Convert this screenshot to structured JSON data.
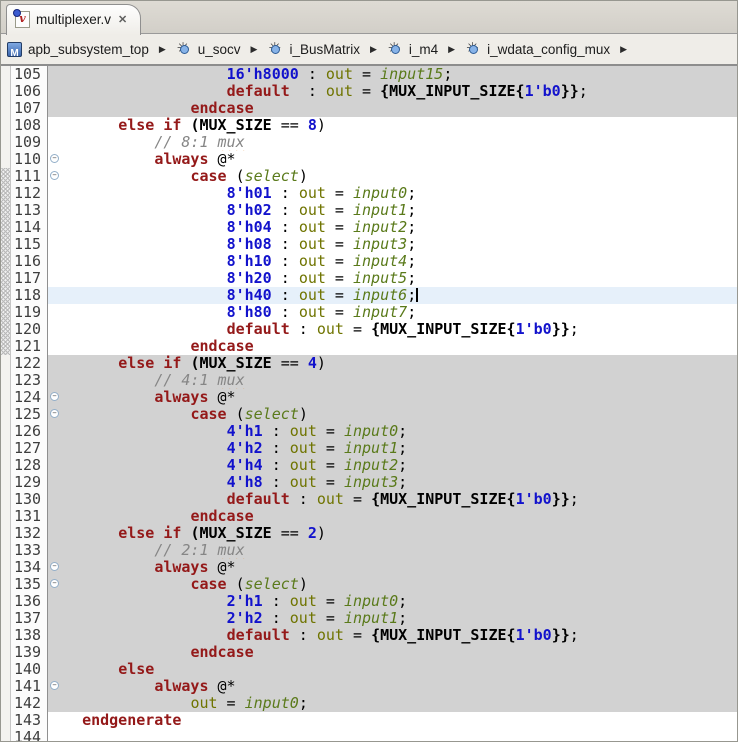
{
  "window": {
    "tab_title": "multiplexer.v",
    "close_glyph": "✕"
  },
  "breadcrumb": {
    "arrow_glyph": "▶",
    "items": [
      {
        "label": "apb_subsystem_top",
        "icon": "module-icon"
      },
      {
        "label": "u_socv",
        "icon": "instance-icon"
      },
      {
        "label": "i_BusMatrix",
        "icon": "instance-icon"
      },
      {
        "label": "i_m4",
        "icon": "instance-icon"
      },
      {
        "label": "i_wdata_config_mux",
        "icon": "instance-icon"
      }
    ],
    "trailing_arrow": true
  },
  "editor": {
    "colors": {
      "keyword": "#941919",
      "literal": "#1212cc",
      "parameter": "#000000",
      "signal_out": "#6f7400",
      "port_italic": "#5a7a1a",
      "comment": "#868686",
      "inactive_block_bg": "#d2d2d2",
      "current_line_bg": "#e6f0fa"
    },
    "fold_glyph": "−",
    "lines": [
      {
        "n": "105",
        "bg": "gray",
        "seg": [
          [
            "t",
            "                  "
          ],
          [
            "n",
            "16'h8000"
          ],
          [
            "t",
            " : "
          ],
          [
            "o",
            "out"
          ],
          [
            "t",
            " = "
          ],
          [
            "i",
            "input15"
          ],
          [
            "t",
            ";"
          ]
        ]
      },
      {
        "n": "106",
        "bg": "gray",
        "seg": [
          [
            "t",
            "                  "
          ],
          [
            "k",
            "default"
          ],
          [
            "t",
            "  : "
          ],
          [
            "o",
            "out"
          ],
          [
            "t",
            " = "
          ],
          [
            "p",
            "{MUX_INPUT_SIZE{"
          ],
          [
            "n",
            "1'b0"
          ],
          [
            "p",
            "}}"
          ],
          [
            "t",
            ";"
          ]
        ]
      },
      {
        "n": "107",
        "bg": "gray",
        "seg": [
          [
            "t",
            "              "
          ],
          [
            "k",
            "endcase"
          ]
        ]
      },
      {
        "n": "108",
        "bg": "white",
        "seg": [
          [
            "t",
            "      "
          ],
          [
            "k",
            "else"
          ],
          [
            "t",
            " "
          ],
          [
            "k",
            "if"
          ],
          [
            "t",
            " "
          ],
          [
            "p",
            "(MUX_SIZE"
          ],
          [
            "t",
            " == "
          ],
          [
            "n",
            "8"
          ],
          [
            "t",
            ")"
          ]
        ]
      },
      {
        "n": "109",
        "bg": "white",
        "seg": [
          [
            "t",
            "          "
          ],
          [
            "c",
            "// 8:1 "
          ],
          [
            "m",
            "mux"
          ]
        ]
      },
      {
        "n": "110",
        "bg": "white",
        "fold": true,
        "seg": [
          [
            "t",
            "          "
          ],
          [
            "k",
            "always"
          ],
          [
            "t",
            " @*"
          ]
        ]
      },
      {
        "n": "111",
        "bg": "white",
        "fold": true,
        "range": true,
        "seg": [
          [
            "t",
            "              "
          ],
          [
            "k",
            "case"
          ],
          [
            "t",
            " ("
          ],
          [
            "i",
            "select"
          ],
          [
            "t",
            ")"
          ]
        ]
      },
      {
        "n": "112",
        "bg": "white",
        "range": true,
        "seg": [
          [
            "t",
            "                  "
          ],
          [
            "n",
            "8'h01"
          ],
          [
            "t",
            " : "
          ],
          [
            "o",
            "out"
          ],
          [
            "t",
            " = "
          ],
          [
            "i",
            "input0"
          ],
          [
            "t",
            ";"
          ]
        ]
      },
      {
        "n": "113",
        "bg": "white",
        "range": true,
        "seg": [
          [
            "t",
            "                  "
          ],
          [
            "n",
            "8'h02"
          ],
          [
            "t",
            " : "
          ],
          [
            "o",
            "out"
          ],
          [
            "t",
            " = "
          ],
          [
            "i",
            "input1"
          ],
          [
            "t",
            ";"
          ]
        ]
      },
      {
        "n": "114",
        "bg": "white",
        "range": true,
        "seg": [
          [
            "t",
            "                  "
          ],
          [
            "n",
            "8'h04"
          ],
          [
            "t",
            " : "
          ],
          [
            "o",
            "out"
          ],
          [
            "t",
            " = "
          ],
          [
            "i",
            "input2"
          ],
          [
            "t",
            ";"
          ]
        ]
      },
      {
        "n": "115",
        "bg": "white",
        "range": true,
        "seg": [
          [
            "t",
            "                  "
          ],
          [
            "n",
            "8'h08"
          ],
          [
            "t",
            " : "
          ],
          [
            "o",
            "out"
          ],
          [
            "t",
            " = "
          ],
          [
            "i",
            "input3"
          ],
          [
            "t",
            ";"
          ]
        ]
      },
      {
        "n": "116",
        "bg": "white",
        "range": true,
        "seg": [
          [
            "t",
            "                  "
          ],
          [
            "n",
            "8'h10"
          ],
          [
            "t",
            " : "
          ],
          [
            "o",
            "out"
          ],
          [
            "t",
            " = "
          ],
          [
            "i",
            "input4"
          ],
          [
            "t",
            ";"
          ]
        ]
      },
      {
        "n": "117",
        "bg": "white",
        "range": true,
        "seg": [
          [
            "t",
            "                  "
          ],
          [
            "n",
            "8'h20"
          ],
          [
            "t",
            " : "
          ],
          [
            "o",
            "out"
          ],
          [
            "t",
            " = "
          ],
          [
            "i",
            "input5"
          ],
          [
            "t",
            ";"
          ]
        ]
      },
      {
        "n": "118",
        "bg": "cur",
        "range": true,
        "caret": true,
        "seg": [
          [
            "t",
            "                  "
          ],
          [
            "n",
            "8'h40"
          ],
          [
            "t",
            " : "
          ],
          [
            "o",
            "out"
          ],
          [
            "t",
            " = "
          ],
          [
            "i",
            "input6"
          ],
          [
            "t",
            ";"
          ]
        ]
      },
      {
        "n": "119",
        "bg": "white",
        "range": true,
        "seg": [
          [
            "t",
            "                  "
          ],
          [
            "n",
            "8'h80"
          ],
          [
            "t",
            " : "
          ],
          [
            "o",
            "out"
          ],
          [
            "t",
            " = "
          ],
          [
            "i",
            "input7"
          ],
          [
            "t",
            ";"
          ]
        ]
      },
      {
        "n": "120",
        "bg": "white",
        "range": true,
        "seg": [
          [
            "t",
            "                  "
          ],
          [
            "k",
            "default"
          ],
          [
            "t",
            " : "
          ],
          [
            "o",
            "out"
          ],
          [
            "t",
            " = "
          ],
          [
            "p",
            "{MUX_INPUT_SIZE{"
          ],
          [
            "n",
            "1'b0"
          ],
          [
            "p",
            "}}"
          ],
          [
            "t",
            ";"
          ]
        ]
      },
      {
        "n": "121",
        "bg": "white",
        "range": true,
        "seg": [
          [
            "t",
            "              "
          ],
          [
            "k",
            "endcase"
          ]
        ]
      },
      {
        "n": "122",
        "bg": "gray",
        "seg": [
          [
            "t",
            "      "
          ],
          [
            "k",
            "else"
          ],
          [
            "t",
            " "
          ],
          [
            "k",
            "if"
          ],
          [
            "t",
            " "
          ],
          [
            "p",
            "(MUX_SIZE"
          ],
          [
            "t",
            " == "
          ],
          [
            "n",
            "4"
          ],
          [
            "t",
            ")"
          ]
        ]
      },
      {
        "n": "123",
        "bg": "gray",
        "seg": [
          [
            "t",
            "          "
          ],
          [
            "c",
            "// 4:1 "
          ],
          [
            "m",
            "mux"
          ]
        ]
      },
      {
        "n": "124",
        "bg": "gray",
        "fold": true,
        "seg": [
          [
            "t",
            "          "
          ],
          [
            "k",
            "always"
          ],
          [
            "t",
            " @*"
          ]
        ]
      },
      {
        "n": "125",
        "bg": "gray",
        "fold": true,
        "seg": [
          [
            "t",
            "              "
          ],
          [
            "k",
            "case"
          ],
          [
            "t",
            " ("
          ],
          [
            "i",
            "select"
          ],
          [
            "t",
            ")"
          ]
        ]
      },
      {
        "n": "126",
        "bg": "gray",
        "seg": [
          [
            "t",
            "                  "
          ],
          [
            "n",
            "4'h1"
          ],
          [
            "t",
            " : "
          ],
          [
            "o",
            "out"
          ],
          [
            "t",
            " = "
          ],
          [
            "i",
            "input0"
          ],
          [
            "t",
            ";"
          ]
        ]
      },
      {
        "n": "127",
        "bg": "gray",
        "seg": [
          [
            "t",
            "                  "
          ],
          [
            "n",
            "4'h2"
          ],
          [
            "t",
            " : "
          ],
          [
            "o",
            "out"
          ],
          [
            "t",
            " = "
          ],
          [
            "i",
            "input1"
          ],
          [
            "t",
            ";"
          ]
        ]
      },
      {
        "n": "128",
        "bg": "gray",
        "seg": [
          [
            "t",
            "                  "
          ],
          [
            "n",
            "4'h4"
          ],
          [
            "t",
            " : "
          ],
          [
            "o",
            "out"
          ],
          [
            "t",
            " = "
          ],
          [
            "i",
            "input2"
          ],
          [
            "t",
            ";"
          ]
        ]
      },
      {
        "n": "129",
        "bg": "gray",
        "seg": [
          [
            "t",
            "                  "
          ],
          [
            "n",
            "4'h8"
          ],
          [
            "t",
            " : "
          ],
          [
            "o",
            "out"
          ],
          [
            "t",
            " = "
          ],
          [
            "i",
            "input3"
          ],
          [
            "t",
            ";"
          ]
        ]
      },
      {
        "n": "130",
        "bg": "gray",
        "seg": [
          [
            "t",
            "                  "
          ],
          [
            "k",
            "default"
          ],
          [
            "t",
            " : "
          ],
          [
            "o",
            "out"
          ],
          [
            "t",
            " = "
          ],
          [
            "p",
            "{MUX_INPUT_SIZE{"
          ],
          [
            "n",
            "1'b0"
          ],
          [
            "p",
            "}}"
          ],
          [
            "t",
            ";"
          ]
        ]
      },
      {
        "n": "131",
        "bg": "gray",
        "seg": [
          [
            "t",
            "              "
          ],
          [
            "k",
            "endcase"
          ]
        ]
      },
      {
        "n": "132",
        "bg": "gray",
        "seg": [
          [
            "t",
            "      "
          ],
          [
            "k",
            "else"
          ],
          [
            "t",
            " "
          ],
          [
            "k",
            "if"
          ],
          [
            "t",
            " "
          ],
          [
            "p",
            "(MUX_SIZE"
          ],
          [
            "t",
            " == "
          ],
          [
            "n",
            "2"
          ],
          [
            "t",
            ")"
          ]
        ]
      },
      {
        "n": "133",
        "bg": "gray",
        "seg": [
          [
            "t",
            "          "
          ],
          [
            "c",
            "// 2:1 "
          ],
          [
            "m",
            "mux"
          ]
        ]
      },
      {
        "n": "134",
        "bg": "gray",
        "fold": true,
        "seg": [
          [
            "t",
            "          "
          ],
          [
            "k",
            "always"
          ],
          [
            "t",
            " @*"
          ]
        ]
      },
      {
        "n": "135",
        "bg": "gray",
        "fold": true,
        "seg": [
          [
            "t",
            "              "
          ],
          [
            "k",
            "case"
          ],
          [
            "t",
            " ("
          ],
          [
            "i",
            "select"
          ],
          [
            "t",
            ")"
          ]
        ]
      },
      {
        "n": "136",
        "bg": "gray",
        "seg": [
          [
            "t",
            "                  "
          ],
          [
            "n",
            "2'h1"
          ],
          [
            "t",
            " : "
          ],
          [
            "o",
            "out"
          ],
          [
            "t",
            " = "
          ],
          [
            "i",
            "input0"
          ],
          [
            "t",
            ";"
          ]
        ]
      },
      {
        "n": "137",
        "bg": "gray",
        "seg": [
          [
            "t",
            "                  "
          ],
          [
            "n",
            "2'h2"
          ],
          [
            "t",
            " : "
          ],
          [
            "o",
            "out"
          ],
          [
            "t",
            " = "
          ],
          [
            "i",
            "input1"
          ],
          [
            "t",
            ";"
          ]
        ]
      },
      {
        "n": "138",
        "bg": "gray",
        "seg": [
          [
            "t",
            "                  "
          ],
          [
            "k",
            "default"
          ],
          [
            "t",
            " : "
          ],
          [
            "o",
            "out"
          ],
          [
            "t",
            " = "
          ],
          [
            "p",
            "{MUX_INPUT_SIZE{"
          ],
          [
            "n",
            "1'b0"
          ],
          [
            "p",
            "}}"
          ],
          [
            "t",
            ";"
          ]
        ]
      },
      {
        "n": "139",
        "bg": "gray",
        "seg": [
          [
            "t",
            "              "
          ],
          [
            "k",
            "endcase"
          ]
        ]
      },
      {
        "n": "140",
        "bg": "gray",
        "seg": [
          [
            "t",
            "      "
          ],
          [
            "k",
            "else"
          ]
        ]
      },
      {
        "n": "141",
        "bg": "gray",
        "fold": true,
        "seg": [
          [
            "t",
            "          "
          ],
          [
            "k",
            "always"
          ],
          [
            "t",
            " @*"
          ]
        ]
      },
      {
        "n": "142",
        "bg": "gray",
        "seg": [
          [
            "t",
            "              "
          ],
          [
            "o",
            "out"
          ],
          [
            "t",
            " = "
          ],
          [
            "i",
            "input0"
          ],
          [
            "t",
            ";"
          ]
        ]
      },
      {
        "n": "143",
        "bg": "white",
        "seg": [
          [
            "t",
            "  "
          ],
          [
            "k",
            "endgenerate"
          ]
        ]
      },
      {
        "n": "144",
        "bg": "white",
        "seg": []
      }
    ]
  }
}
